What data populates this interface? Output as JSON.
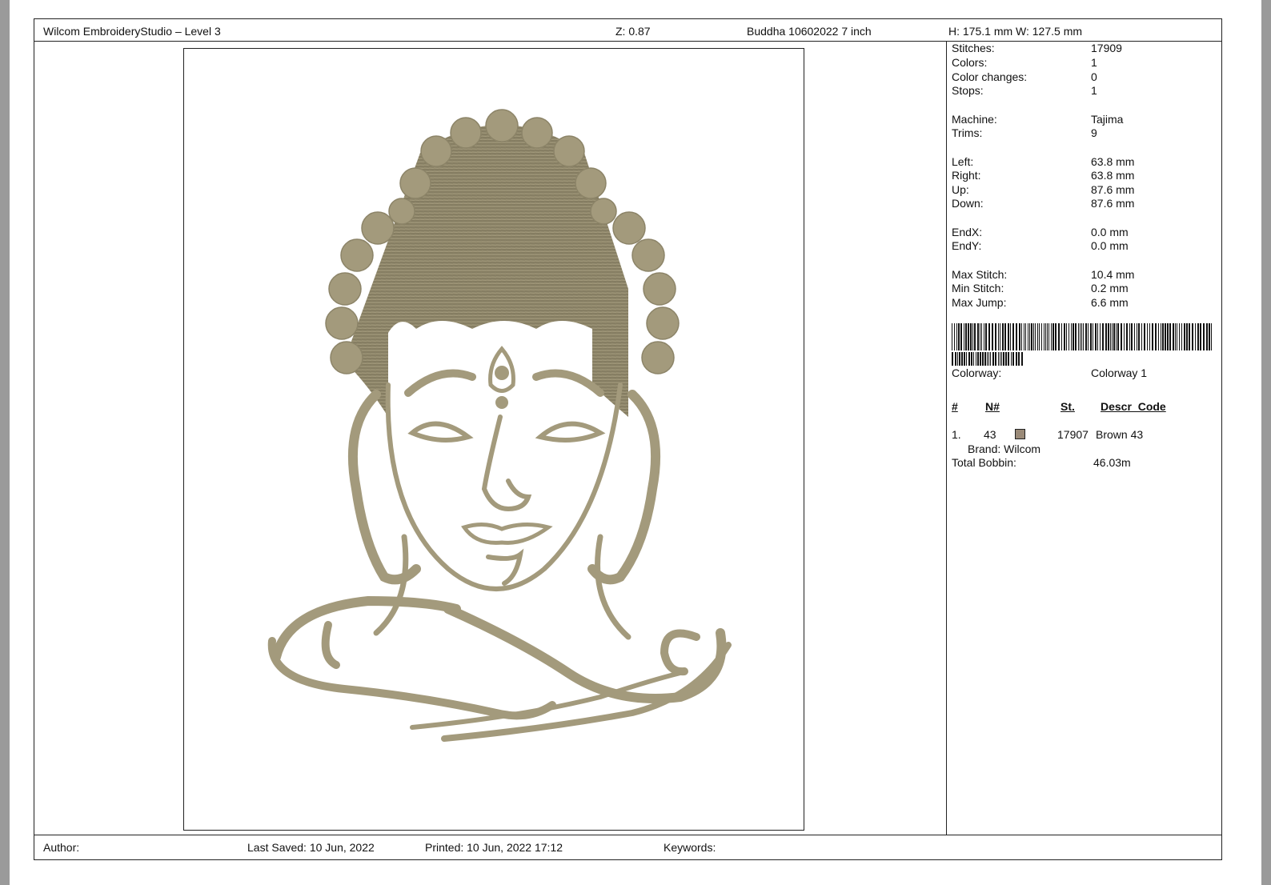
{
  "header": {
    "app_title": "Wilcom EmbroideryStudio – Level 3",
    "zoom": "Z: 0.87",
    "design_name": "Buddha 10602022 7 inch",
    "dimensions": "H: 175.1 mm   W: 127.5 mm"
  },
  "info": {
    "stitches": {
      "label": "Stitches:",
      "value": "17909"
    },
    "colors": {
      "label": "Colors:",
      "value": "1"
    },
    "color_changes": {
      "label": "Color changes:",
      "value": "0"
    },
    "stops": {
      "label": "Stops:",
      "value": "1"
    },
    "machine": {
      "label": "Machine:",
      "value": "Tajima"
    },
    "trims": {
      "label": "Trims:",
      "value": "9"
    },
    "left": {
      "label": "Left:",
      "value": "63.8 mm"
    },
    "right": {
      "label": "Right:",
      "value": "63.8 mm"
    },
    "up": {
      "label": "Up:",
      "value": "87.6 mm"
    },
    "down": {
      "label": "Down:",
      "value": "87.6 mm"
    },
    "endx": {
      "label": "EndX:",
      "value": "0.0 mm"
    },
    "endy": {
      "label": "EndY:",
      "value": "0.0 mm"
    },
    "max_stitch": {
      "label": "Max Stitch:",
      "value": "10.4 mm"
    },
    "min_stitch": {
      "label": "Min Stitch:",
      "value": "0.2 mm"
    },
    "max_jump": {
      "label": "Max Jump:",
      "value": "6.6 mm"
    },
    "colorway": {
      "label": "Colorway:",
      "value": "Colorway 1"
    }
  },
  "color_table": {
    "headers": {
      "num": "#",
      "n": "N#",
      "st": "St.",
      "descr": "Descr_Code"
    },
    "rows": [
      {
        "num": "1.",
        "n": "43",
        "st": "17907",
        "descr": "Brown 43",
        "brand": "Brand: Wilcom",
        "color": "#9a8a78"
      }
    ],
    "total_bobbin": {
      "label": "Total Bobbin:",
      "value": "46.03m"
    }
  },
  "footer": {
    "author": "Author:",
    "last_saved": "Last Saved: 10 Jun, 2022",
    "printed": "Printed: 10 Jun, 2022 17:12",
    "keywords": "Keywords:"
  },
  "colors": {
    "thread": "#a39a7c",
    "thread_dark": "#8c8468",
    "background": "#9a9a9a"
  }
}
